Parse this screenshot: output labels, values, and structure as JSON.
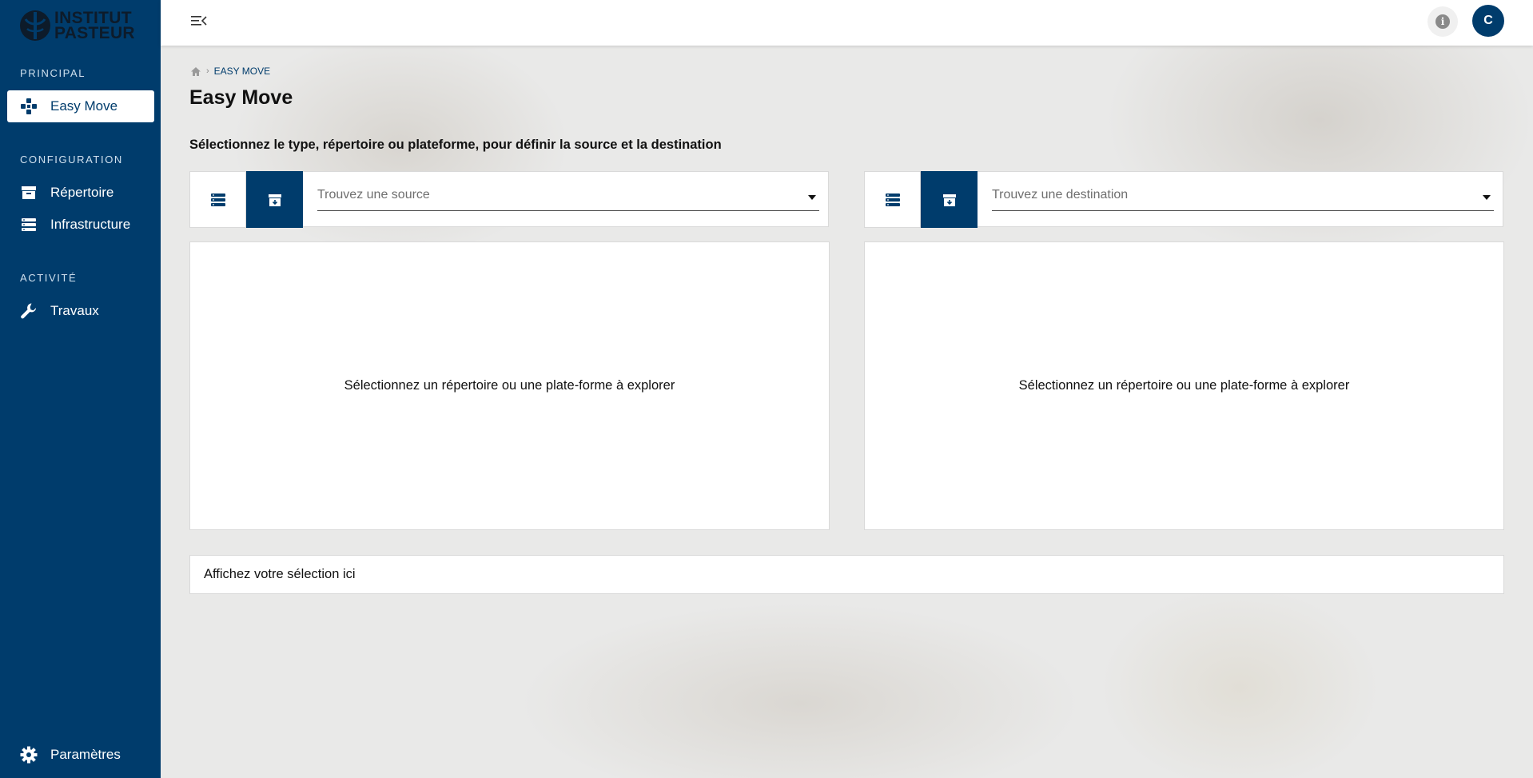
{
  "app": {
    "logo_text_line1": "INSTITUT",
    "logo_text_line2": "PASTEUR",
    "brand_color": "#003c6c"
  },
  "sidebar": {
    "sections": [
      {
        "title": "PRINCIPAL"
      },
      {
        "title": "CONFIGURATION"
      },
      {
        "title": "ACTIVITÉ"
      }
    ],
    "items": [
      {
        "label": "Easy Move",
        "icon": "gamepad-icon",
        "active": true
      },
      {
        "label": "Répertoire",
        "icon": "archive-icon"
      },
      {
        "label": "Infrastructure",
        "icon": "server-icon"
      },
      {
        "label": "Travaux",
        "icon": "wrench-icon"
      }
    ],
    "footer_item": {
      "label": "Paramètres",
      "icon": "gear-icon"
    }
  },
  "topbar": {
    "menu_icon": "menu-collapse-icon",
    "info_icon": "info-icon",
    "avatar_initial": "C"
  },
  "breadcrumb": {
    "home_icon": "home-icon",
    "current": "EASY MOVE"
  },
  "page": {
    "title": "Easy Move",
    "instructions": "Sélectionnez le type, répertoire ou plateforme, pour définir la source et la destination"
  },
  "source": {
    "placeholder": "Trouvez une source",
    "empty_message": "Sélectionnez un répertoire ou une plate-forme à explorer"
  },
  "destination": {
    "placeholder": "Trouvez une destination",
    "empty_message": "Sélectionnez un répertoire ou une plate-forme à explorer"
  },
  "selection": {
    "label": "Affichez votre sélection ici"
  }
}
